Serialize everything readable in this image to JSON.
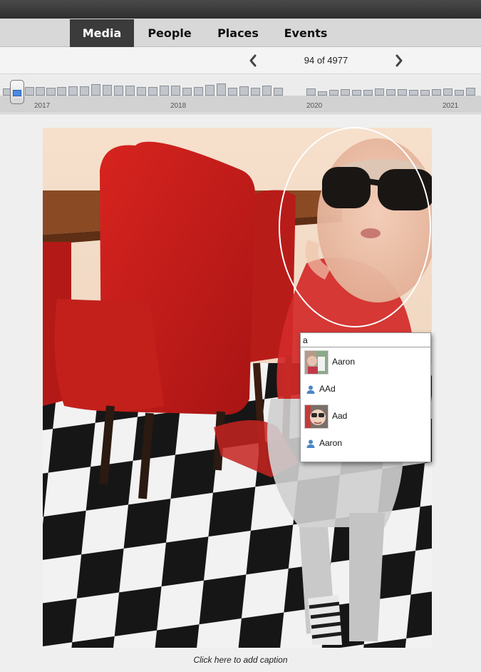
{
  "tabs": [
    {
      "label": "Media",
      "active": true
    },
    {
      "label": "People",
      "active": false
    },
    {
      "label": "Places",
      "active": false
    },
    {
      "label": "Events",
      "active": false
    }
  ],
  "navigation": {
    "counter": "94 of 4977",
    "prev_icon": "chevron-left-icon",
    "next_icon": "chevron-right-icon"
  },
  "timeline": {
    "years": [
      "2017",
      "2018",
      "2020",
      "2021"
    ],
    "handle_icon": "timeline-slider-handle"
  },
  "tag_editor": {
    "input_value": "a",
    "suggestions": [
      {
        "name": "Aaron",
        "icon": "photo-thumbnail"
      },
      {
        "name": "AAd",
        "icon": "person-icon"
      },
      {
        "name": "Aad",
        "icon": "photo-thumbnail"
      },
      {
        "name": "Aaron",
        "icon": "person-icon"
      }
    ]
  },
  "caption": "Click here to add caption",
  "colors": {
    "active_tab": "#3b3b3b",
    "chair_red": "#c01c1c",
    "person_icon_blue": "#4a86c6"
  }
}
